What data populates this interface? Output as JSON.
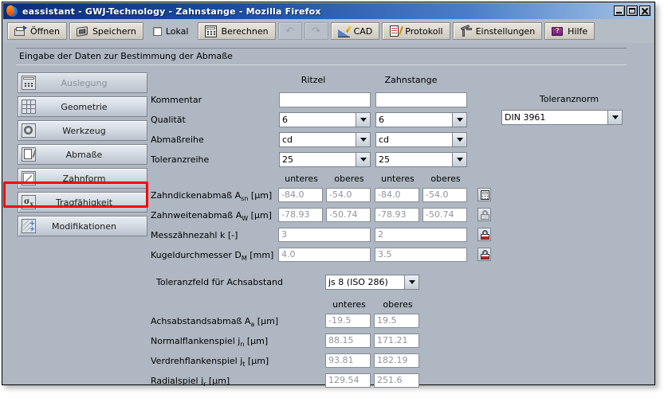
{
  "window": {
    "title": "eassistant - GWJ-Technology - Zahnstange - Mozilla Firefox",
    "app_icon": "firefox-icon",
    "controls": {
      "minimize": "minimize-icon",
      "maximize": "maximize-icon",
      "close": "close-icon"
    }
  },
  "toolbar": {
    "buttons": [
      {
        "label": "Öffnen",
        "icon": "open-folder-icon",
        "enabled": true
      },
      {
        "label": "Speichern",
        "icon": "save-disk-icon",
        "enabled": true
      },
      {
        "label": "Lokal",
        "icon": "checkbox-icon",
        "enabled": true,
        "checked": false
      },
      {
        "label": "Berechnen",
        "icon": "calculator-icon",
        "enabled": true
      },
      {
        "label": "",
        "icon": "undo-icon",
        "enabled": false
      },
      {
        "label": "",
        "icon": "redo-icon",
        "enabled": false
      },
      {
        "label": "CAD",
        "icon": "cad-icon",
        "enabled": true
      },
      {
        "label": "Protokoll",
        "icon": "protocol-icon",
        "enabled": true
      },
      {
        "label": "Einstellungen",
        "icon": "settings-icon",
        "enabled": true
      },
      {
        "label": "Hilfe",
        "icon": "help-book-icon",
        "enabled": true
      }
    ],
    "undo_glyph": "↶",
    "redo_glyph": "↷"
  },
  "section": {
    "heading": "Eingabe der Daten zur Bestimmung der Abmaße"
  },
  "sidebar": {
    "items": [
      {
        "label": "Auslegung",
        "icon": "calculator-icon",
        "enabled": false,
        "selected": false
      },
      {
        "label": "Geometrie",
        "icon": "grid-icon",
        "enabled": true,
        "selected": false
      },
      {
        "label": "Werkzeug",
        "icon": "gear-icon",
        "enabled": true,
        "selected": false
      },
      {
        "label": "Abmaße",
        "icon": "document-pen-icon",
        "enabled": true,
        "selected": true
      },
      {
        "label": "Zahnform",
        "icon": "curve-icon",
        "enabled": true,
        "selected": false
      },
      {
        "label": "Tragfähigkeit",
        "icon": "sigma-icon",
        "enabled": true,
        "selected": false
      },
      {
        "label": "Modifikationen",
        "icon": "modification-icon",
        "enabled": true,
        "selected": false
      }
    ],
    "annotation_color": "#ff0000",
    "annotation_target": "Abmaße"
  },
  "form": {
    "column_headers": {
      "col1": "Ritzel",
      "col2": "Zahnstange"
    },
    "toleranznorm": {
      "label": "Toleranznorm",
      "value": "DIN 3961"
    },
    "rows": [
      {
        "label": "Kommentar",
        "type": "text",
        "ritzel": "",
        "zahnstange": ""
      },
      {
        "label": "Qualität",
        "type": "combo",
        "ritzel": "6",
        "zahnstange": "6"
      },
      {
        "label": "Abmaßreihe",
        "type": "combo",
        "ritzel": "cd",
        "zahnstange": "cd"
      },
      {
        "label": "Toleranzreihe",
        "type": "combo",
        "ritzel": "25",
        "zahnstange": "25"
      }
    ],
    "subheaders": {
      "unteres": "unteres",
      "oberes": "oberes"
    },
    "measurements": [
      {
        "label_main": "Zahndickenabmaß A",
        "label_sub": "sn",
        "label_unit": " [µm]",
        "ritzel_unteres": "-84.0",
        "ritzel_oberes": "-54.0",
        "zahnstange_unteres": "-84.0",
        "zahnstange_oberes": "-54.0",
        "action_icon": "calculator-icon",
        "action_state": "enabled",
        "span": false
      },
      {
        "label_main": "Zahnweitenabmaß A",
        "label_sub": "W",
        "label_unit": " [µm]",
        "ritzel_unteres": "-78.93",
        "ritzel_oberes": "-50.74",
        "zahnstange_unteres": "-78.93",
        "zahnstange_oberes": "-50.74",
        "action_icon": "lock-icon",
        "action_state": "disabled",
        "span": false
      },
      {
        "label_main": "Messzähnezahl k [-]",
        "label_sub": "",
        "label_unit": "",
        "ritzel_span": "3",
        "zahnstange_span": "2",
        "action_icon": "lock-icon",
        "action_state": "locked",
        "span": true
      },
      {
        "label_main": "Kugeldurchmesser D",
        "label_sub": "M",
        "label_unit": " [mm]",
        "ritzel_span": "4.0",
        "zahnstange_span": "3.5",
        "action_icon": "lock-icon",
        "action_state": "locked",
        "span": true
      }
    ],
    "toleranzfeld": {
      "label": "Toleranzfeld für Achsabstand",
      "value": "js 8 (ISO 286)"
    },
    "clearance_headers": {
      "unteres": "unteres",
      "oberes": "oberes"
    },
    "clearance_rows": [
      {
        "label_main": "Achsabstandsabmaß A",
        "label_sub": "a",
        "label_unit": " [µm]",
        "unteres": "-19.5",
        "oberes": "19.5"
      },
      {
        "label_main": "Normalflankenspiel j",
        "label_sub": "n",
        "label_unit": " [µm]",
        "unteres": "88.15",
        "oberes": "171.21"
      },
      {
        "label_main": "Verdrehflankenspiel j",
        "label_sub": "t",
        "label_unit": " [µm]",
        "unteres": "93.81",
        "oberes": "182.19"
      },
      {
        "label_main": "Radialspiel j",
        "label_sub": "r",
        "label_unit": " [µm]",
        "unteres": "129.54",
        "oberes": "251.6"
      }
    ]
  },
  "colors": {
    "window_bg": "#aeb7c2",
    "titlebar_start": "#0b2e7a",
    "titlebar_end": "#a8c6e8",
    "toolbar_bg": "#b4bcc6",
    "field_text": "#8f959e",
    "annotation": "#ff0000"
  }
}
